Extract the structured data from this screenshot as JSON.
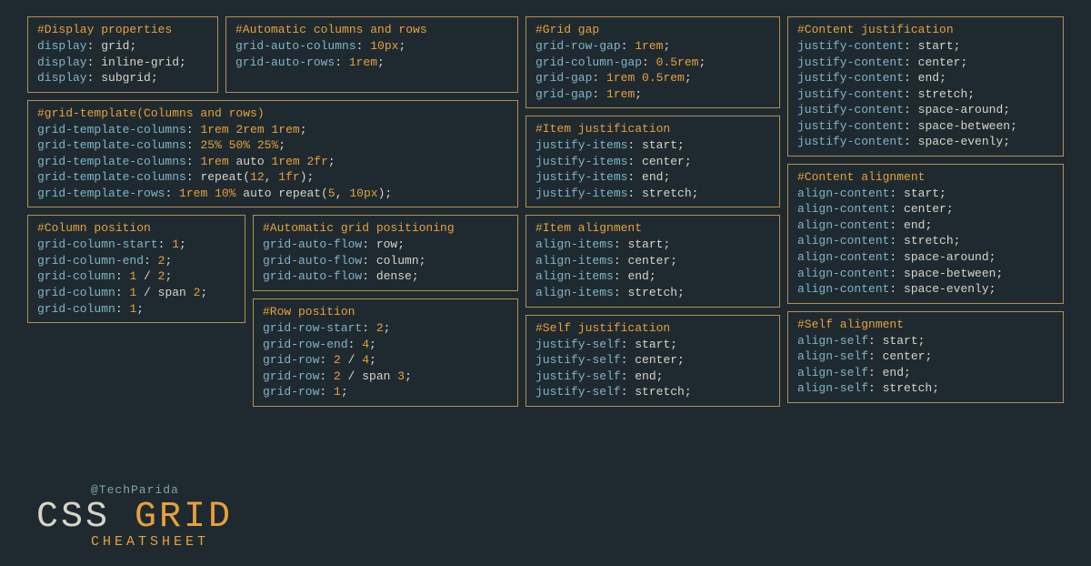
{
  "branding": {
    "handle": "@TechParida",
    "title_css": "CSS ",
    "title_grid": "GRID",
    "subtitle": "CHEATSHEET"
  },
  "cards": {
    "display": {
      "title": "#Display properties",
      "lines": [
        {
          "prop": "display",
          "tokens": [
            {
              "t": "val",
              "v": " grid"
            }
          ]
        },
        {
          "prop": "display",
          "tokens": [
            {
              "t": "val",
              "v": " inline-grid"
            }
          ]
        },
        {
          "prop": "display",
          "tokens": [
            {
              "t": "val",
              "v": " subgrid"
            }
          ]
        }
      ]
    },
    "auto_cols_rows": {
      "title": "#Automatic columns and rows",
      "lines": [
        {
          "prop": "grid-auto-columns",
          "tokens": [
            {
              "t": "num",
              "v": " 10px"
            }
          ]
        },
        {
          "prop": "grid-auto-rows",
          "tokens": [
            {
              "t": "num",
              "v": " 1rem"
            }
          ]
        }
      ]
    },
    "grid_template": {
      "title": "#grid-template(Columns and rows)",
      "lines": [
        {
          "prop": "grid-template-columns",
          "tokens": [
            {
              "t": "num",
              "v": " 1rem"
            },
            {
              "t": "num",
              "v": " 2rem"
            },
            {
              "t": "num",
              "v": " 1rem"
            }
          ]
        },
        {
          "prop": "grid-template-columns",
          "tokens": [
            {
              "t": "num",
              "v": " 25%"
            },
            {
              "t": "num",
              "v": " 50%"
            },
            {
              "t": "num",
              "v": " 25%"
            }
          ]
        },
        {
          "prop": "grid-template-columns",
          "tokens": [
            {
              "t": "num",
              "v": " 1rem"
            },
            {
              "t": "val",
              "v": " auto"
            },
            {
              "t": "num",
              "v": " 1rem"
            },
            {
              "t": "num",
              "v": " 2fr"
            }
          ]
        },
        {
          "prop": "grid-template-columns",
          "tokens": [
            {
              "t": "val",
              "v": " repeat("
            },
            {
              "t": "num",
              "v": "12"
            },
            {
              "t": "val",
              "v": ", "
            },
            {
              "t": "num",
              "v": "1fr"
            },
            {
              "t": "val",
              "v": ")"
            }
          ]
        },
        {
          "prop": "grid-template-rows",
          "tokens": [
            {
              "t": "num",
              "v": " 1rem"
            },
            {
              "t": "num",
              "v": " 10%"
            },
            {
              "t": "val",
              "v": " auto"
            },
            {
              "t": "val",
              "v": " repeat("
            },
            {
              "t": "num",
              "v": "5"
            },
            {
              "t": "val",
              "v": ", "
            },
            {
              "t": "num",
              "v": "10px"
            },
            {
              "t": "val",
              "v": ")"
            }
          ]
        }
      ]
    },
    "col_pos": {
      "title": "#Column position",
      "lines": [
        {
          "prop": "grid-column-start",
          "tokens": [
            {
              "t": "num",
              "v": " 1"
            }
          ]
        },
        {
          "prop": "grid-column-end",
          "tokens": [
            {
              "t": "num",
              "v": " 2"
            }
          ]
        },
        {
          "prop": "grid-column",
          "tokens": [
            {
              "t": "num",
              "v": " 1"
            },
            {
              "t": "val",
              "v": " / "
            },
            {
              "t": "num",
              "v": "2"
            }
          ]
        },
        {
          "prop": "grid-column",
          "tokens": [
            {
              "t": "num",
              "v": " 1"
            },
            {
              "t": "val",
              "v": " / span "
            },
            {
              "t": "num",
              "v": "2"
            }
          ]
        },
        {
          "prop": "grid-column",
          "tokens": [
            {
              "t": "num",
              "v": " 1"
            }
          ]
        }
      ]
    },
    "auto_pos": {
      "title": "#Automatic grid positioning",
      "lines": [
        {
          "prop": "grid-auto-flow",
          "tokens": [
            {
              "t": "val",
              "v": " row"
            }
          ]
        },
        {
          "prop": "grid-auto-flow",
          "tokens": [
            {
              "t": "val",
              "v": " column"
            }
          ]
        },
        {
          "prop": "grid-auto-flow",
          "tokens": [
            {
              "t": "val",
              "v": " dense"
            }
          ]
        }
      ]
    },
    "row_pos": {
      "title": "#Row position",
      "lines": [
        {
          "prop": "grid-row-start",
          "tokens": [
            {
              "t": "num",
              "v": " 2"
            }
          ]
        },
        {
          "prop": "grid-row-end",
          "tokens": [
            {
              "t": "num",
              "v": " 4"
            }
          ]
        },
        {
          "prop": "grid-row",
          "tokens": [
            {
              "t": "num",
              "v": " 2"
            },
            {
              "t": "val",
              "v": " / "
            },
            {
              "t": "num",
              "v": "4"
            }
          ]
        },
        {
          "prop": "grid-row",
          "tokens": [
            {
              "t": "num",
              "v": " 2"
            },
            {
              "t": "val",
              "v": " / span "
            },
            {
              "t": "num",
              "v": "3"
            }
          ]
        },
        {
          "prop": "grid-row",
          "tokens": [
            {
              "t": "num",
              "v": " 1"
            }
          ]
        }
      ]
    },
    "grid_gap": {
      "title": "#Grid gap",
      "lines": [
        {
          "prop": "grid-row-gap",
          "tokens": [
            {
              "t": "num",
              "v": " 1rem"
            }
          ]
        },
        {
          "prop": "grid-column-gap",
          "tokens": [
            {
              "t": "num",
              "v": " 0.5rem"
            }
          ]
        },
        {
          "prop": "grid-gap",
          "tokens": [
            {
              "t": "num",
              "v": " 1rem"
            },
            {
              "t": "num",
              "v": " 0.5rem"
            }
          ]
        },
        {
          "prop": "grid-gap",
          "tokens": [
            {
              "t": "num",
              "v": " 1rem"
            }
          ]
        }
      ]
    },
    "item_just": {
      "title": "#Item justification",
      "lines": [
        {
          "prop": "justify-items",
          "tokens": [
            {
              "t": "val",
              "v": " start"
            }
          ]
        },
        {
          "prop": "justify-items",
          "tokens": [
            {
              "t": "val",
              "v": " center"
            }
          ]
        },
        {
          "prop": "justify-items",
          "tokens": [
            {
              "t": "val",
              "v": " end"
            }
          ]
        },
        {
          "prop": "justify-items",
          "tokens": [
            {
              "t": "val",
              "v": " stretch"
            }
          ]
        }
      ]
    },
    "item_align": {
      "title": "#Item alignment",
      "lines": [
        {
          "prop": "align-items",
          "tokens": [
            {
              "t": "val",
              "v": " start"
            }
          ]
        },
        {
          "prop": "align-items",
          "tokens": [
            {
              "t": "val",
              "v": " center"
            }
          ]
        },
        {
          "prop": "align-items",
          "tokens": [
            {
              "t": "val",
              "v": " end"
            }
          ]
        },
        {
          "prop": "align-items",
          "tokens": [
            {
              "t": "val",
              "v": " stretch"
            }
          ]
        }
      ]
    },
    "self_just": {
      "title": "#Self justification",
      "lines": [
        {
          "prop": "justify-self",
          "tokens": [
            {
              "t": "val",
              "v": " start"
            }
          ]
        },
        {
          "prop": "justify-self",
          "tokens": [
            {
              "t": "val",
              "v": " center"
            }
          ]
        },
        {
          "prop": "justify-self",
          "tokens": [
            {
              "t": "val",
              "v": " end"
            }
          ]
        },
        {
          "prop": "justify-self",
          "tokens": [
            {
              "t": "val",
              "v": " stretch"
            }
          ]
        }
      ]
    },
    "content_just": {
      "title": "#Content justification",
      "lines": [
        {
          "prop": "justify-content",
          "tokens": [
            {
              "t": "val",
              "v": " start"
            }
          ]
        },
        {
          "prop": "justify-content",
          "tokens": [
            {
              "t": "val",
              "v": " center"
            }
          ]
        },
        {
          "prop": "justify-content",
          "tokens": [
            {
              "t": "val",
              "v": " end"
            }
          ]
        },
        {
          "prop": "justify-content",
          "tokens": [
            {
              "t": "val",
              "v": " stretch"
            }
          ]
        },
        {
          "prop": "justify-content",
          "tokens": [
            {
              "t": "val",
              "v": " space-around"
            }
          ]
        },
        {
          "prop": "justify-content",
          "tokens": [
            {
              "t": "val",
              "v": " space-between"
            }
          ]
        },
        {
          "prop": "justify-content",
          "tokens": [
            {
              "t": "val",
              "v": " space-evenly"
            }
          ]
        }
      ]
    },
    "content_align": {
      "title": "#Content alignment",
      "lines": [
        {
          "prop": "align-content",
          "tokens": [
            {
              "t": "val",
              "v": " start"
            }
          ]
        },
        {
          "prop": "align-content",
          "tokens": [
            {
              "t": "val",
              "v": " center"
            }
          ]
        },
        {
          "prop": "align-content",
          "tokens": [
            {
              "t": "val",
              "v": " end"
            }
          ]
        },
        {
          "prop": "align-content",
          "tokens": [
            {
              "t": "val",
              "v": " stretch"
            }
          ]
        },
        {
          "prop": "align-content",
          "tokens": [
            {
              "t": "val",
              "v": " space-around"
            }
          ]
        },
        {
          "prop": "align-content",
          "tokens": [
            {
              "t": "val",
              "v": " space-between"
            }
          ]
        },
        {
          "prop": "align-content",
          "tokens": [
            {
              "t": "val",
              "v": " space-evenly"
            }
          ]
        }
      ]
    },
    "self_align": {
      "title": "#Self alignment",
      "lines": [
        {
          "prop": "align-self",
          "tokens": [
            {
              "t": "val",
              "v": " start"
            }
          ]
        },
        {
          "prop": "align-self",
          "tokens": [
            {
              "t": "val",
              "v": " center"
            }
          ]
        },
        {
          "prop": "align-self",
          "tokens": [
            {
              "t": "val",
              "v": " end"
            }
          ]
        },
        {
          "prop": "align-self",
          "tokens": [
            {
              "t": "val",
              "v": " stretch"
            }
          ]
        }
      ]
    }
  }
}
